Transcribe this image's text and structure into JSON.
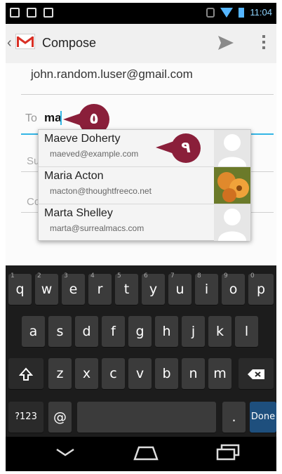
{
  "status_bar": {
    "time": "11:04"
  },
  "action_bar": {
    "title": "Compose"
  },
  "compose": {
    "from": "john.random.luser@gmail.com",
    "to_label": "To",
    "to_value": "ma",
    "hint_subject": "Su",
    "hint_compose": "Co"
  },
  "callouts": [
    {
      "label": "٥"
    },
    {
      "label": "٩"
    }
  ],
  "suggestions": [
    {
      "name": "Maeve Doherty",
      "email": "maeved@example.com",
      "avatar": "default-avatar"
    },
    {
      "name": "Maria Acton",
      "email": "macton@thoughtfreeco.net",
      "avatar": "flower-photo"
    },
    {
      "name": "Marta Shelley",
      "email": "marta@surrealmacs.com",
      "avatar": "default-avatar"
    }
  ],
  "keyboard": {
    "row1": [
      {
        "key": "q",
        "num": "1"
      },
      {
        "key": "w",
        "num": "2"
      },
      {
        "key": "e",
        "num": "3"
      },
      {
        "key": "r",
        "num": "4"
      },
      {
        "key": "t",
        "num": "5"
      },
      {
        "key": "y",
        "num": "6"
      },
      {
        "key": "u",
        "num": "7"
      },
      {
        "key": "i",
        "num": "8"
      },
      {
        "key": "o",
        "num": "9"
      },
      {
        "key": "p",
        "num": "0"
      }
    ],
    "row2": [
      "a",
      "s",
      "d",
      "f",
      "g",
      "h",
      "j",
      "k",
      "l"
    ],
    "row3": [
      "z",
      "x",
      "c",
      "v",
      "b",
      "n",
      "m"
    ],
    "symbols_label": "?123",
    "at_label": "@",
    "period_label": ".",
    "done_label": "Done"
  },
  "colors": {
    "accent": "#33b5e5",
    "callout": "#8a1f3a",
    "key": "#3b3b3b",
    "done_key": "#1e4f7d"
  }
}
